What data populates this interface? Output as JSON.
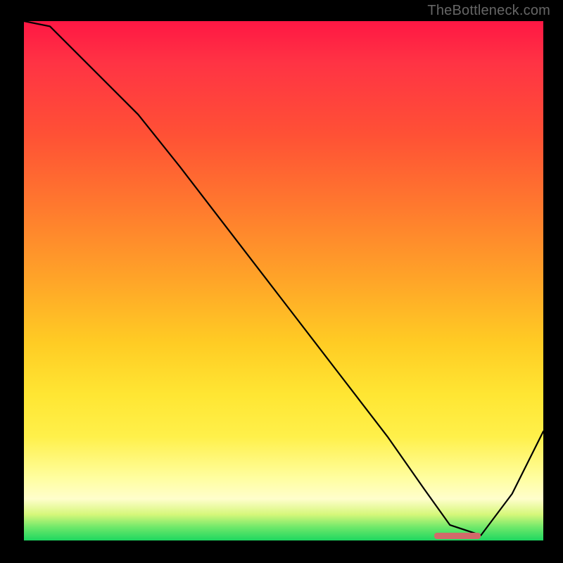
{
  "watermark": "TheBottleneck.com",
  "chart_data": {
    "type": "line",
    "title": "",
    "xlabel": "",
    "ylabel": "",
    "xlim": [
      0,
      100
    ],
    "ylim": [
      0,
      100
    ],
    "x": [
      0,
      5,
      22,
      30,
      40,
      50,
      60,
      70,
      77,
      82,
      88,
      94,
      100
    ],
    "values": [
      100,
      99,
      82,
      72,
      59,
      46,
      33,
      20,
      10,
      3,
      1,
      9,
      21
    ],
    "annotations": [
      {
        "kind": "marker-band",
        "x_start": 79,
        "x_end": 88,
        "y": 0.5,
        "color": "#d26a6a"
      }
    ],
    "background": "vertical-gradient red→orange→yellow→green"
  }
}
